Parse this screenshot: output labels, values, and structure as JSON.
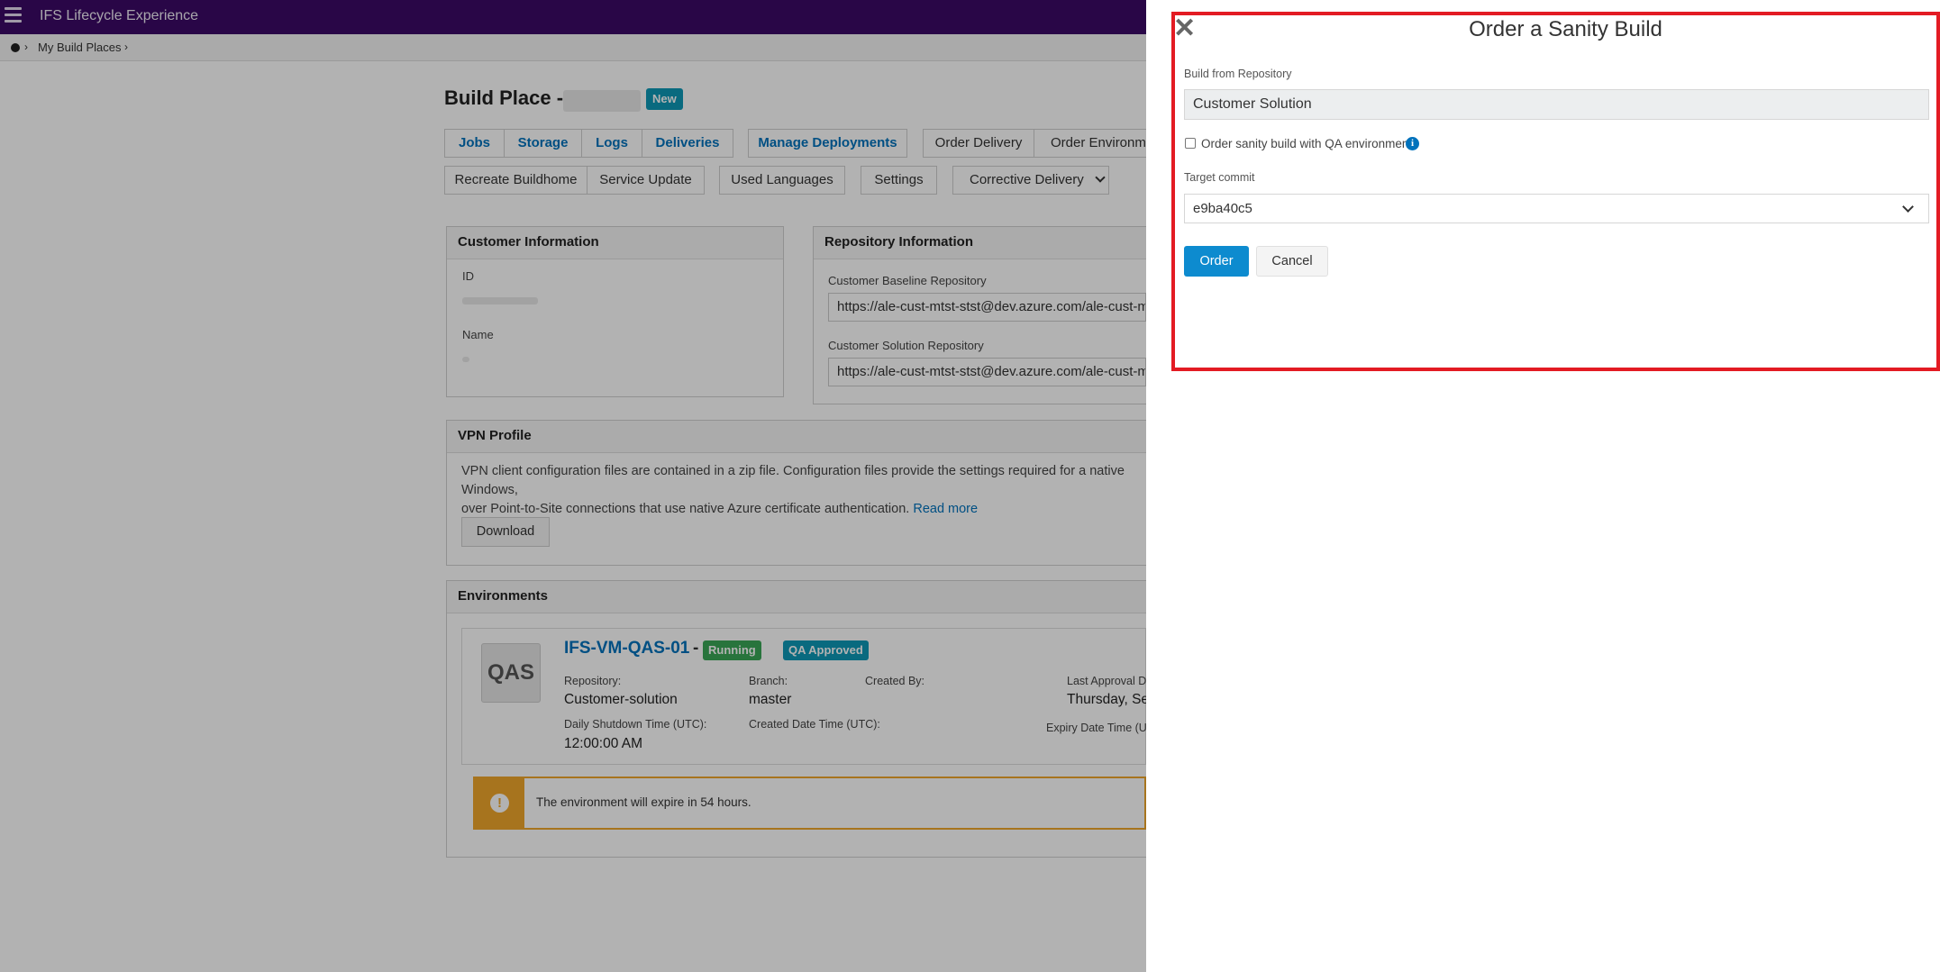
{
  "header": {
    "app_title": "IFS Lifecycle Experience"
  },
  "breadcrumb": {
    "link": "My Build Places"
  },
  "page": {
    "title_prefix": "Build Place -",
    "badge": "New"
  },
  "tabs_row1": [
    "Jobs",
    "Storage",
    "Logs",
    "Deliveries",
    "Manage Deployments",
    "Order Delivery",
    "Order Environmen"
  ],
  "tabs_row2": [
    "Recreate Buildhome",
    "Service Update",
    "Used Languages",
    "Settings",
    "Corrective Delivery"
  ],
  "customer_info": {
    "title": "Customer Information",
    "id_label": "ID",
    "name_label": "Name"
  },
  "repo_info": {
    "title": "Repository Information",
    "baseline_label": "Customer Baseline Repository",
    "baseline_value": "https://ale-cust-mtst-stst@dev.azure.com/ale-cust-m",
    "solution_label": "Customer Solution Repository",
    "solution_value": "https://ale-cust-mtst-stst@dev.azure.com/ale-cust-m"
  },
  "vpn": {
    "title": "VPN Profile",
    "text_line1": "VPN client configuration files are contained in a zip file. Configuration files provide the settings required for a native Windows,",
    "text_line2": "over Point-to-Site connections that use native Azure certificate authentication.",
    "read_more": "Read more",
    "download": "Download"
  },
  "environments": {
    "title": "Environments",
    "env": {
      "icon_text": "QAS",
      "name": "IFS-VM-QAS-01",
      "dash": "-",
      "status": "Running",
      "approval": "QA Approved",
      "repository_label": "Repository:",
      "repository_value": "Customer-solution",
      "branch_label": "Branch:",
      "branch_value": "master",
      "created_by_label": "Created By:",
      "last_approval_label": "Last Approval Da",
      "last_approval_value": "Thursday, Se",
      "shutdown_label": "Daily Shutdown Time (UTC):",
      "shutdown_value": "12:00:00 AM",
      "created_date_label": "Created Date Time (UTC):",
      "expiry_label": "Expiry Date Time (UT",
      "alert": "The environment will expire in 54 hours."
    }
  },
  "dialog": {
    "title": "Order a Sanity Build",
    "build_from_label": "Build from Repository",
    "build_from_value": "Customer Solution",
    "qa_checkbox_label": "Order sanity build with QA environment",
    "qa_checked": false,
    "target_commit_label": "Target commit",
    "target_commit_value": "e9ba40c5",
    "order_button": "Order",
    "cancel_button": "Cancel"
  },
  "colors": {
    "topbar": "#3b0a66",
    "link": "#0072bc",
    "badge_new": "#0e99b6",
    "running": "#3aa657",
    "qa_approved": "#0e99b6",
    "warning": "#f0a72c",
    "dialog_border": "#e31b23",
    "primary_button": "#0d8bcf"
  }
}
